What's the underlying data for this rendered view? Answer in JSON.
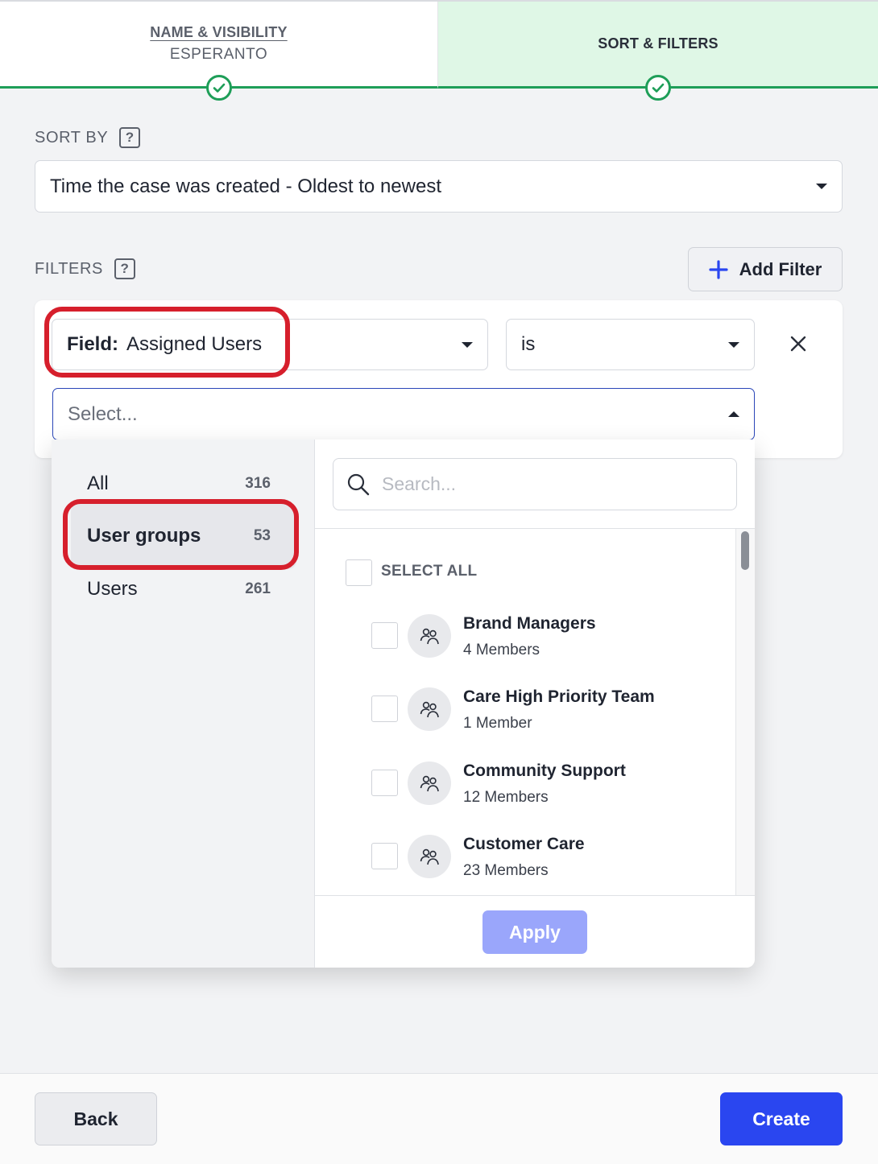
{
  "steps": [
    {
      "title": "NAME & VISIBILITY",
      "subtitle": "ESPERANTO",
      "status": "complete"
    },
    {
      "title": "SORT & FILTERS",
      "status": "complete"
    }
  ],
  "sort": {
    "label": "SORT BY",
    "value": "Time the case was created - Oldest to newest"
  },
  "filters": {
    "label": "FILTERS",
    "add_button": "Add Filter",
    "field_label": "Field:",
    "field_value": "Assigned Users",
    "operator": "is",
    "value_placeholder": "Select..."
  },
  "dropdown": {
    "categories": [
      {
        "name": "All",
        "count": "316",
        "active": false
      },
      {
        "name": "User groups",
        "count": "53",
        "active": true
      },
      {
        "name": "Users",
        "count": "261",
        "active": false
      }
    ],
    "search_placeholder": "Search...",
    "select_all_label": "SELECT ALL",
    "groups": [
      {
        "name": "Brand Managers",
        "members": "4 Members"
      },
      {
        "name": "Care High Priority Team",
        "members": "1 Member"
      },
      {
        "name": "Community Support",
        "members": "12 Members"
      },
      {
        "name": "Customer Care",
        "members": "23 Members"
      }
    ],
    "apply_label": "Apply"
  },
  "footer": {
    "back_label": "Back",
    "create_label": "Create"
  },
  "colors": {
    "success": "#1e9e58",
    "primary": "#2a46f0",
    "highlight": "#d61f2c",
    "apply_disabled": "#9aa6fb"
  },
  "icons": [
    "check-circle-icon",
    "help-icon",
    "chevron-down-icon",
    "chevron-up-icon",
    "plus-icon",
    "close-icon",
    "search-icon",
    "user-group-icon"
  ]
}
